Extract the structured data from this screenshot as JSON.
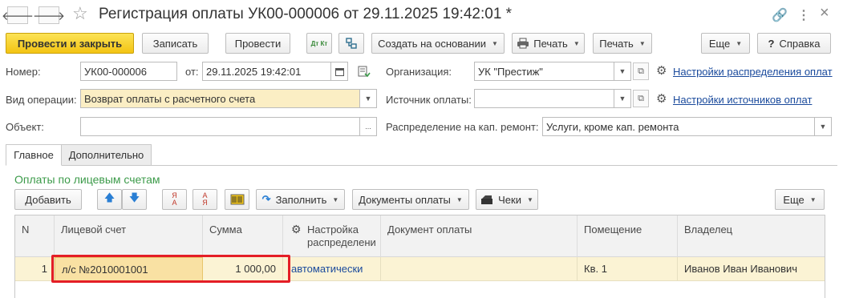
{
  "window": {
    "title": "Регистрация оплаты УК00-000006 от 29.11.2025 19:42:01 *",
    "back_glyph": "🡐",
    "forward_glyph": "🡒",
    "star_glyph": "☆",
    "link_glyph": "🔗",
    "more_glyph": "⋮",
    "close_glyph": "×"
  },
  "toolbar": {
    "post_close": "Провести и закрыть",
    "write": "Записать",
    "post": "Провести",
    "dt_kt": "Дт Кт",
    "create_based": "Создать на основании",
    "print1": "Печать",
    "print2": "Печать",
    "more": "Еще",
    "help": "Справка",
    "help_glyph": "?"
  },
  "form": {
    "number_label": "Номер:",
    "number_value": "УК00-000006",
    "date_label": "от:",
    "date_value": "29.11.2025 19:42:01",
    "org_label": "Организация:",
    "org_value": "УК \"Престиж\"",
    "settings_distribution_link": "Настройки распределения оплат",
    "operation_label": "Вид операции:",
    "operation_value": "Возврат оплаты с расчетного счета",
    "source_label": "Источник оплаты:",
    "source_value": "",
    "settings_sources_link": "Настройки источников оплат",
    "object_label": "Объект:",
    "object_value": "",
    "repair_label": "Распределение на кап. ремонт:",
    "repair_value": "Услуги, кроме кап. ремонта",
    "select_glyph": "...",
    "dropdown_glyph": "▼"
  },
  "tabs": {
    "main": "Главное",
    "extra": "Дополнительно"
  },
  "payments": {
    "section_title": "Оплаты по лицевым счетам",
    "add": "Добавить",
    "fill": "Заполнить",
    "payment_docs": "Документы оплаты",
    "checks": "Чеки",
    "more": "Еще",
    "up_glyph": "🡅",
    "down_glyph": "🡇",
    "sort_az": "Я А",
    "sort_za": "А Я"
  },
  "grid": {
    "columns": {
      "n": "N",
      "account": "Лицевой счет",
      "sum": "Сумма",
      "distribution": "Настройка распределени",
      "document": "Документ оплаты",
      "room": "Помещение",
      "owner": "Владелец"
    },
    "rows": [
      {
        "n": "1",
        "account": "л/с №2010001001",
        "sum": "1 000,00",
        "distribution": "автоматически",
        "document": "",
        "room": "Кв. 1",
        "owner": "Иванов Иван Иванович"
      }
    ]
  },
  "colors": {
    "primary_button": "#f3c413",
    "section_title": "#3c9b4a",
    "link": "#1a4a9c",
    "row_highlight": "#fbf3d4",
    "annotation_box": "#e41e26"
  }
}
